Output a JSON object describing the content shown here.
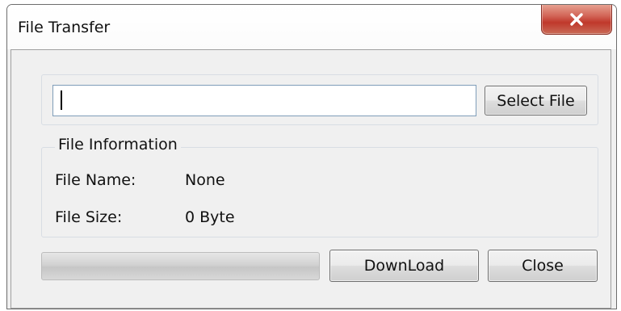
{
  "window": {
    "title": "File Transfer"
  },
  "title_bar": {
    "close_icon": "close-x-icon"
  },
  "file_select": {
    "path_value": "",
    "select_button_label": "Select File"
  },
  "file_info": {
    "group_label": "File Information",
    "name_label": "File Name:",
    "name_value": "None",
    "size_label": "File Size:",
    "size_value": "0 Byte"
  },
  "transfer": {
    "progress_fraction": 0,
    "download_button_label": "DownLoad",
    "close_button_label": "Close"
  },
  "colors": {
    "close_button_red": "#c0382b",
    "window_face": "#f0f0f0",
    "input_border": "#7f9db9"
  }
}
